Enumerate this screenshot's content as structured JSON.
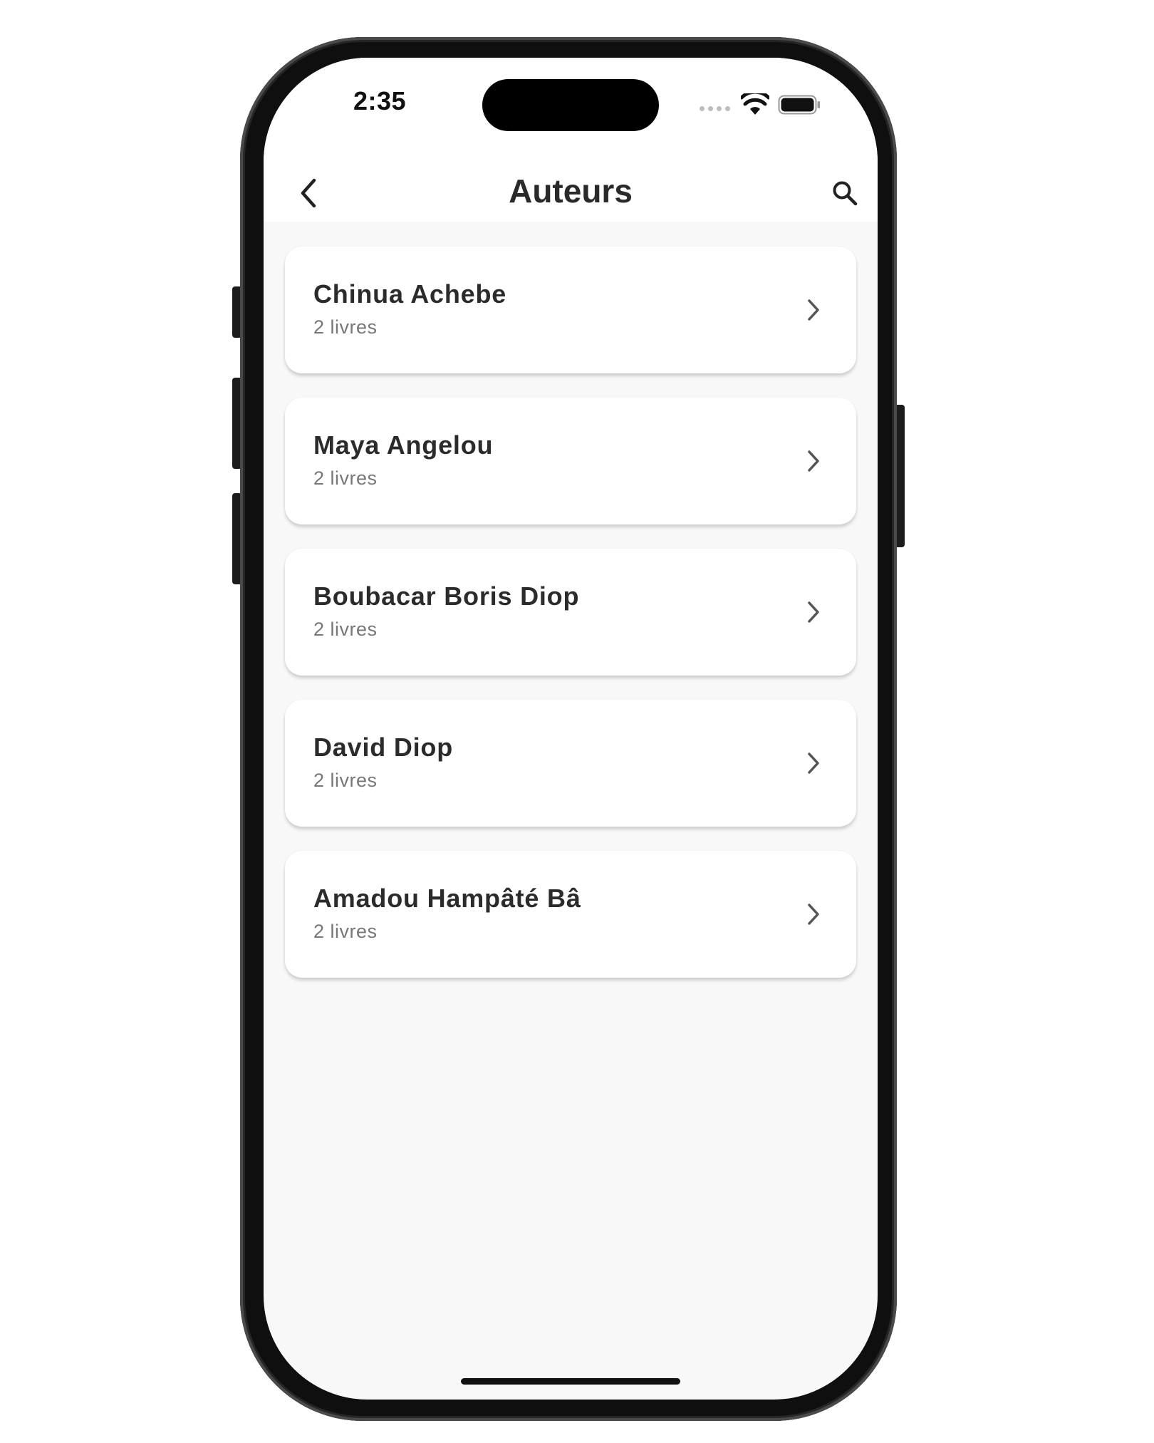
{
  "status_bar": {
    "time": "2:35",
    "icons": [
      "cellular-dots-icon",
      "wifi-icon",
      "battery-icon"
    ]
  },
  "nav": {
    "title": "Auteurs",
    "back_icon": "chevron-left-icon",
    "search_icon": "search-icon"
  },
  "authors": [
    {
      "name": "Chinua Achebe",
      "count": "2 livres"
    },
    {
      "name": "Maya Angelou",
      "count": "2 livres"
    },
    {
      "name": "Boubacar Boris Diop",
      "count": "2 livres"
    },
    {
      "name": "David Diop",
      "count": "2 livres"
    },
    {
      "name": "Amadou Hampâté Bâ",
      "count": "2 livres"
    }
  ],
  "colors": {
    "background": "#f8f8f8",
    "card": "#ffffff",
    "title_text": "#2a2a2a",
    "secondary_text": "#777777"
  }
}
